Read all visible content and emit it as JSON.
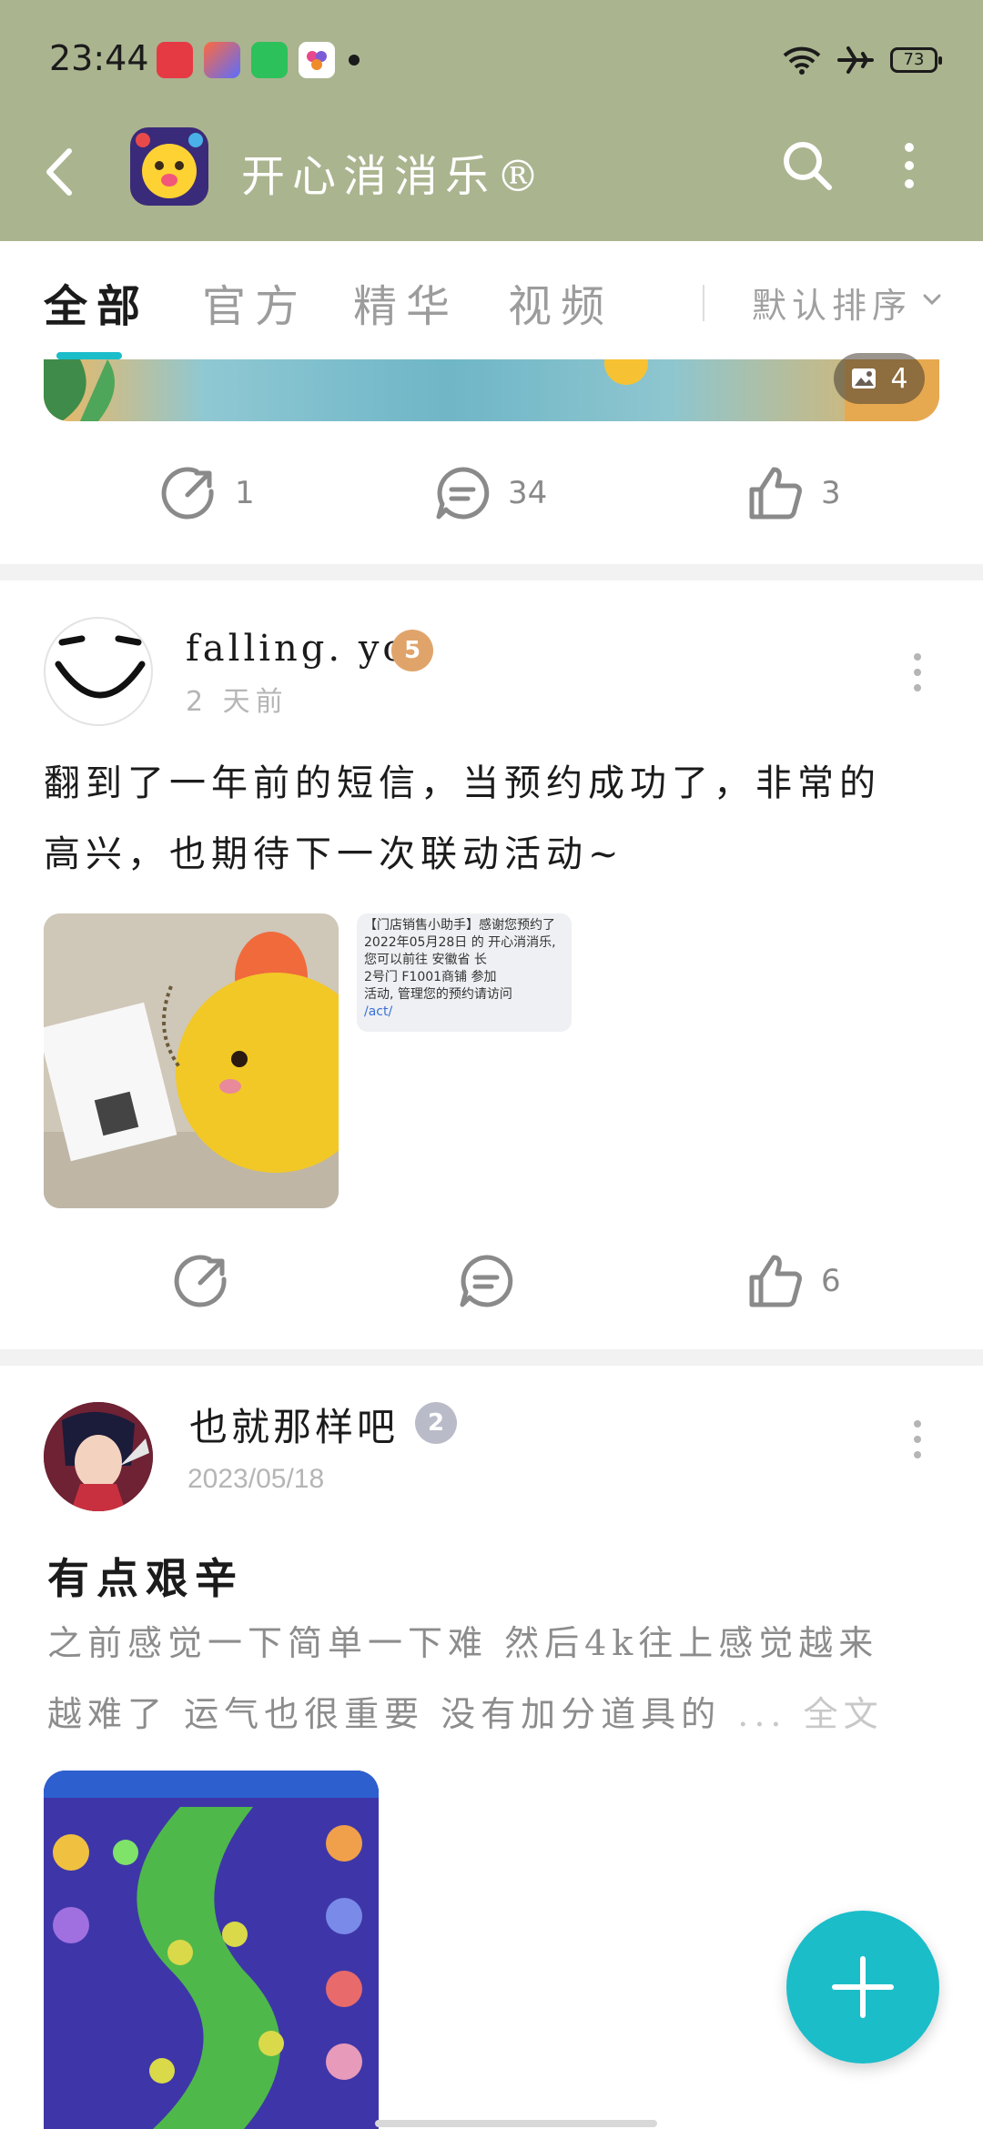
{
  "status_bar": {
    "time": "23:44",
    "battery": "73"
  },
  "nav": {
    "title": "开心消消乐®"
  },
  "tabs": {
    "items": [
      "全部",
      "官方",
      "精华",
      "视频"
    ],
    "active": "全部",
    "sort_label": "默认排序"
  },
  "post0": {
    "image_count": "4",
    "share_count": "1",
    "comment_count": "34",
    "like_count": "3"
  },
  "post1": {
    "username": "falling. you",
    "level": "5",
    "date": "2 天前",
    "text_line1": "翻到了一年前的短信，当预约成功了，非常的",
    "text_line2": "高兴，也期待下一次联动活动~",
    "sms_lines": [
      "【门店销售小助手】感谢您预约了",
      "2022年05月28日 的 开心消消乐,",
      "您可以前往 安徽省          长",
      "          2号门 F1001商铺 参加",
      "活动, 管理您的预约请访问"
    ],
    "sms_link": "          /act/",
    "share_count": "",
    "comment_count": "",
    "like_count": "6"
  },
  "post2": {
    "username": "也就那样吧",
    "level": "2",
    "date": "2023/05/18",
    "title": "有点艰辛",
    "excerpt_line1": "之前感觉一下简单一下难 然后4k往上感觉越来",
    "excerpt_line2": "越难了 运气也很重要 没有加分道具的",
    "excerpt_more": "... 全文"
  },
  "colors": {
    "header_bg": "#aab48f",
    "accent": "#1bbdc9",
    "muted": "#8a8a8a"
  }
}
